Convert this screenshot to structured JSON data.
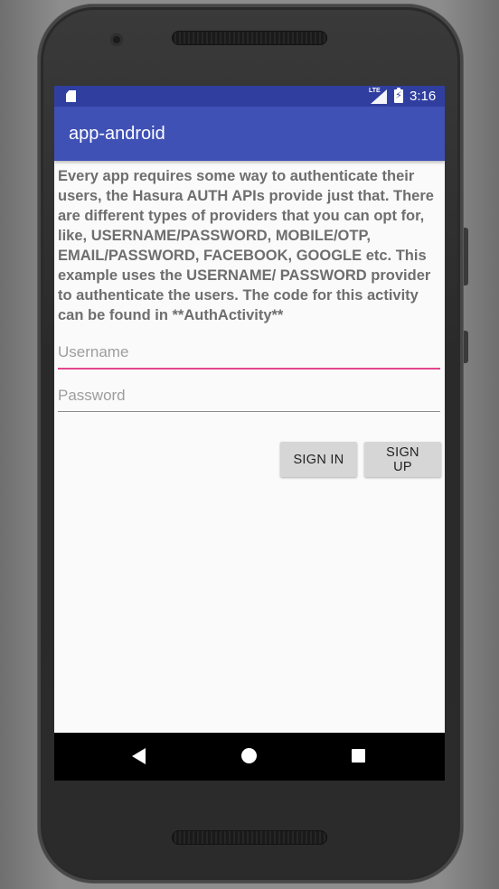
{
  "status_bar": {
    "network": "LTE",
    "battery_icon": "battery-charging-icon",
    "time": "3:16"
  },
  "app_bar": {
    "title": "app-android",
    "color": "#3f51b5",
    "status_color": "#303f9f"
  },
  "main": {
    "description": "Every app requires some way to authenticate their users, the Hasura AUTH APIs provide just that. There are different types of providers that you can opt for, like, USERNAME/PASSWORD, MOBILE/OTP, EMAIL/PASSWORD, FACEBOOK, GOOGLE etc. This example uses the USERNAME/ PASSWORD provider to authenticate the users. The code for this activity can be found in **AuthActivity**",
    "username": {
      "placeholder": "Username",
      "value": ""
    },
    "password": {
      "placeholder": "Password",
      "value": ""
    },
    "sign_in_label": "SIGN IN",
    "sign_up_label": "SIGN UP",
    "focus_color": "#e3458c"
  },
  "nav_bar": {
    "back_icon": "back-triangle-icon",
    "home_icon": "home-circle-icon",
    "recents_icon": "recents-square-icon"
  }
}
